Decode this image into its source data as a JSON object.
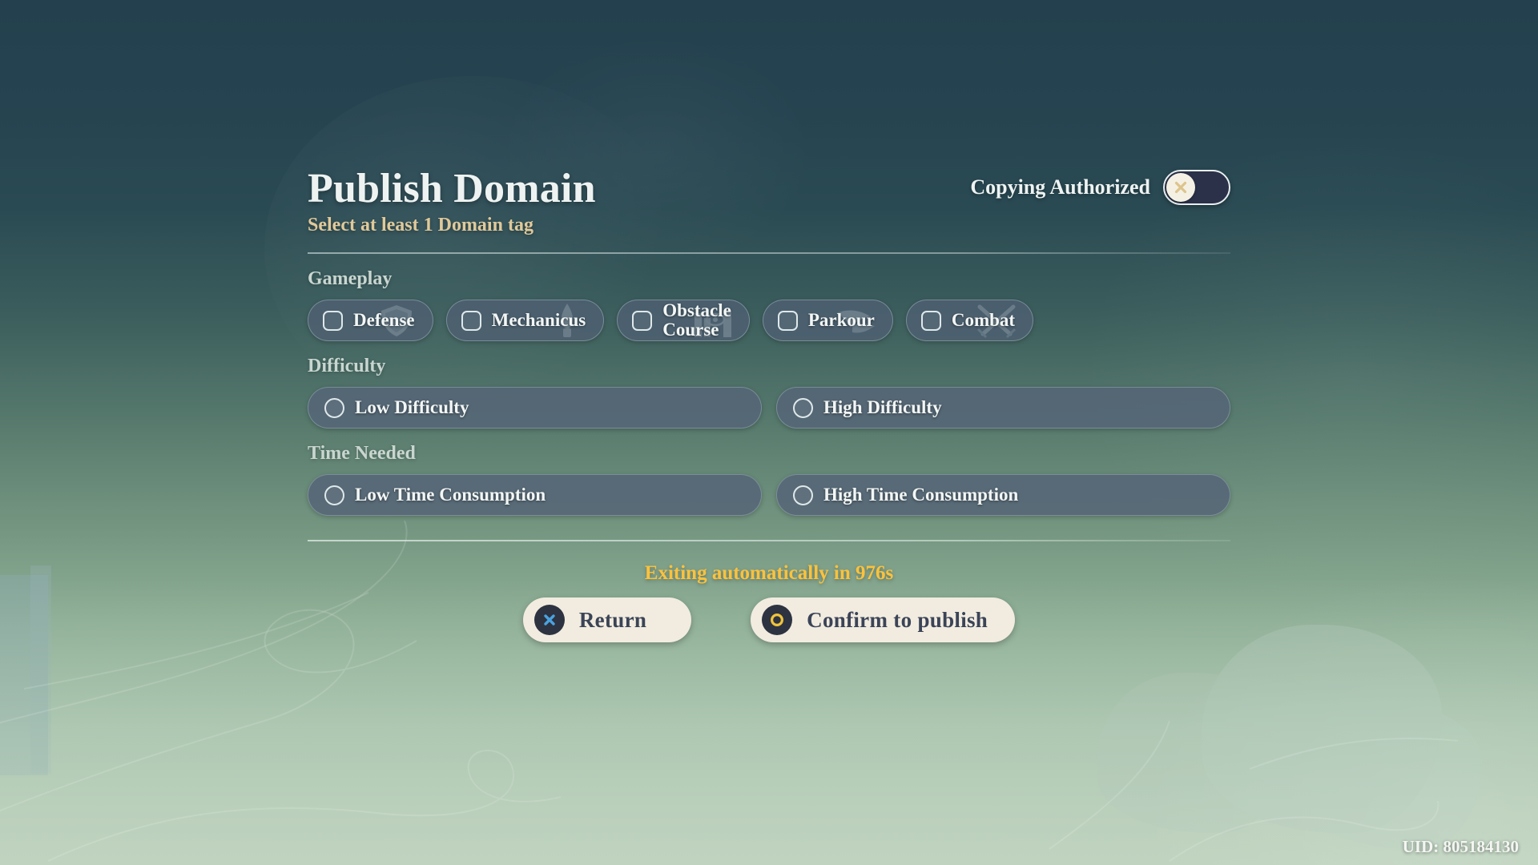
{
  "header": {
    "title": "Publish Domain",
    "subtitle": "Select at least 1 Domain tag",
    "copying_label": "Copying Authorized",
    "copying_state": "off"
  },
  "groups": {
    "gameplay": {
      "label": "Gameplay",
      "tags": [
        {
          "label": "Defense",
          "icon": "shield-icon",
          "checked": false
        },
        {
          "label": "Mechanicus",
          "icon": "mechanism-icon",
          "checked": false
        },
        {
          "label": "Obstacle\nCourse",
          "icon": "obstacle-icon",
          "checked": false
        },
        {
          "label": "Parkour",
          "icon": "wing-icon",
          "checked": false
        },
        {
          "label": "Combat",
          "icon": "crossed-swords-icon",
          "checked": false
        }
      ]
    },
    "difficulty": {
      "label": "Difficulty",
      "options": [
        {
          "label": "Low Difficulty",
          "selected": false
        },
        {
          "label": "High Difficulty",
          "selected": false
        }
      ]
    },
    "time_needed": {
      "label": "Time Needed",
      "options": [
        {
          "label": "Low Time Consumption",
          "selected": false
        },
        {
          "label": "High Time Consumption",
          "selected": false
        }
      ]
    }
  },
  "footer": {
    "timer_text": "Exiting automatically in 976s",
    "return_label": "Return",
    "confirm_label": "Confirm to publish",
    "uid": "UID: 805184130"
  },
  "colors": {
    "accent_gold": "#e0c99a",
    "timer_yellow": "#fcc23c",
    "button_cream": "#f2ece0",
    "pill_slate": "#4e5f71",
    "title_white": "#eef3f2",
    "return_x_blue": "#4aa3e0",
    "confirm_ring_gold": "#f0c33c"
  }
}
